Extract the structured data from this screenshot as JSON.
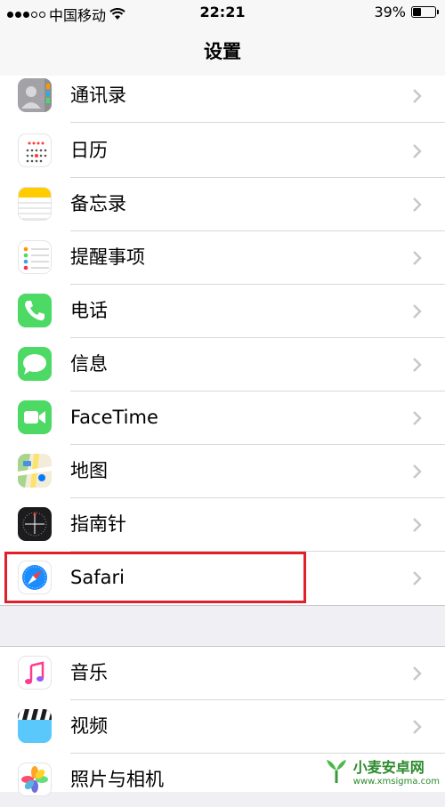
{
  "status": {
    "carrier": "中国移动",
    "time": "22:21",
    "battery": "39%",
    "battery_level": 0.39
  },
  "nav": {
    "title": "设置"
  },
  "group1": [
    {
      "label": "通讯录",
      "icon": "contacts-icon"
    },
    {
      "label": "日历",
      "icon": "calendar-icon"
    },
    {
      "label": "备忘录",
      "icon": "notes-icon"
    },
    {
      "label": "提醒事项",
      "icon": "reminders-icon"
    },
    {
      "label": "电话",
      "icon": "phone-icon"
    },
    {
      "label": "信息",
      "icon": "messages-icon"
    },
    {
      "label": "FaceTime",
      "icon": "facetime-icon"
    },
    {
      "label": "地图",
      "icon": "maps-icon"
    },
    {
      "label": "指南针",
      "icon": "compass-icon"
    },
    {
      "label": "Safari",
      "icon": "safari-icon"
    }
  ],
  "group2": [
    {
      "label": "音乐",
      "icon": "music-icon"
    },
    {
      "label": "视频",
      "icon": "videos-icon"
    },
    {
      "label": "照片与相机",
      "icon": "photos-icon"
    }
  ],
  "watermark": {
    "title": "小麦安卓网",
    "url": "www.xmsigma.com"
  },
  "colors": {
    "highlight": "#e01f2a",
    "phone": "#4cd964",
    "safari": "#1a8cff"
  }
}
